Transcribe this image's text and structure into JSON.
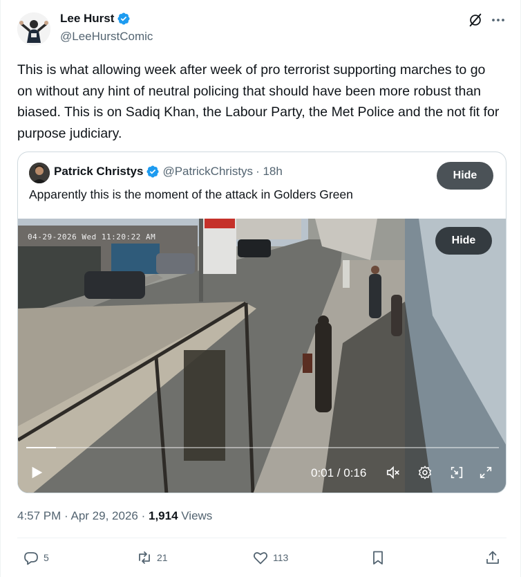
{
  "author": {
    "name": "Lee Hurst",
    "handle": "@LeeHurstComic"
  },
  "tweet_text": "This is what allowing week after week of pro terrorist supporting marches to go on without any hint of neutral policing that should have been more robust than biased. This is on Sadiq Khan, the Labour Party, the Met Police and the not fit for purpose judiciary.",
  "quote": {
    "name": "Patrick Christys",
    "handle": "@PatrickChristys",
    "time": "· 18h",
    "text": "Apparently this is the moment of the attack in Golders Green",
    "hide_label": "Hide",
    "video": {
      "hide_label": "Hide",
      "cam_stamp": "04-29-2026 Wed 11:20:22 AM",
      "time_display": "0:01 / 0:16",
      "progress": 0.0625
    }
  },
  "meta": {
    "time": "4:57 PM",
    "date": "Apr 29, 2026",
    "views_count": "1,914",
    "views_label": "Views"
  },
  "actions": {
    "replies": "5",
    "reposts": "21",
    "likes": "113"
  },
  "colors": {
    "verified": "#1d9bf0",
    "muted": "#536471",
    "text": "#0f1419"
  },
  "icons": [
    "verified-icon",
    "grok-icon",
    "more-icon",
    "play-icon",
    "mute-icon",
    "settings-icon",
    "pip-icon",
    "fullscreen-icon",
    "reply-icon",
    "repost-icon",
    "like-icon",
    "bookmark-icon",
    "share-icon"
  ]
}
